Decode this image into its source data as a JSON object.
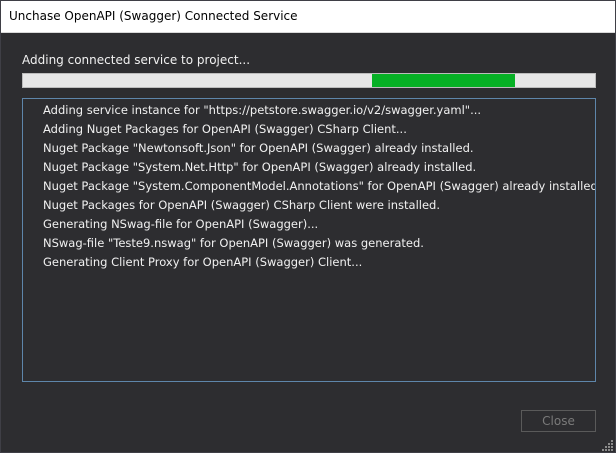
{
  "window": {
    "title": "Unchase OpenAPI (Swagger) Connected Service"
  },
  "status": {
    "text": "Adding connected service to project...",
    "progress": {
      "start_percent": 61.0,
      "end_percent": 86.0,
      "fill_color": "#06b025"
    }
  },
  "log": {
    "lines": [
      "Adding service instance for \"https://petstore.swagger.io/v2/swagger.yaml\"...",
      "Adding Nuget Packages for OpenAPI (Swagger) CSharp Client...",
      "Nuget Package \"Newtonsoft.Json\" for OpenAPI (Swagger) already installed.",
      "Nuget Package \"System.Net.Http\" for OpenAPI (Swagger) already installed.",
      "Nuget Package \"System.ComponentModel.Annotations\" for OpenAPI (Swagger) already installed.",
      "Nuget Packages for OpenAPI (Swagger) CSharp Client were installed.",
      "Generating NSwag-file for OpenAPI (Swagger)...",
      "NSwag-file \"Teste9.nswag\" for OpenAPI (Swagger) was generated.",
      "Generating Client Proxy for OpenAPI (Swagger) Client..."
    ]
  },
  "footer": {
    "close_label": "Close"
  },
  "colors": {
    "background": "#2d2d30",
    "text": "#f1f1f1",
    "log_border": "#5e86aa",
    "disabled_text": "#7a7a7a"
  },
  "icons": {
    "resize": "resize-grip-icon"
  }
}
